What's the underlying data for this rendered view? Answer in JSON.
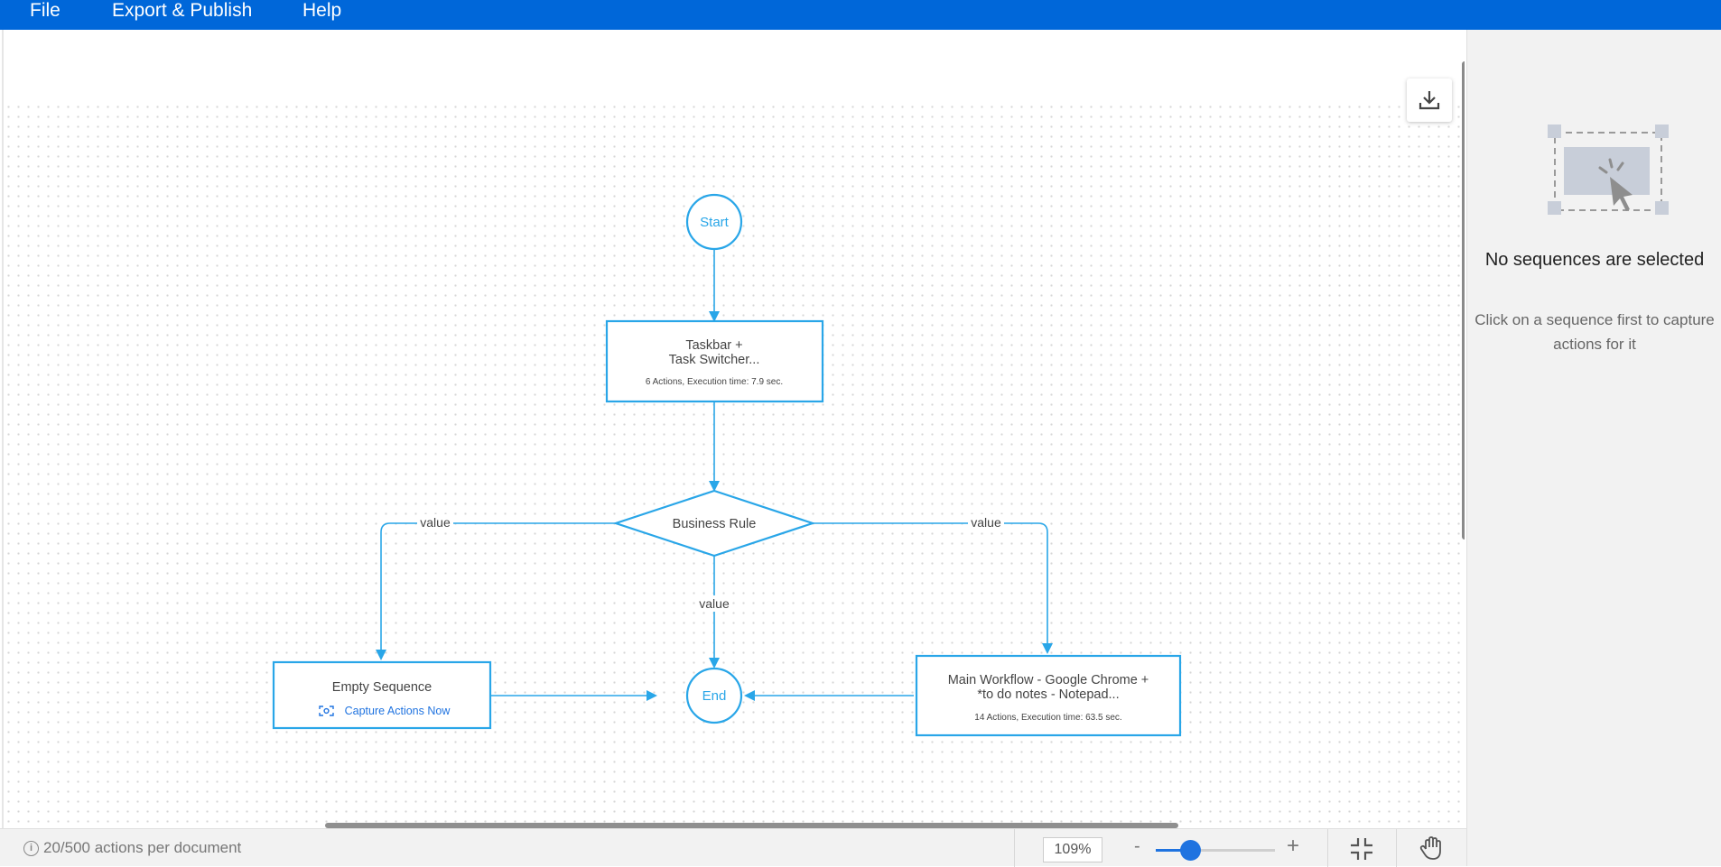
{
  "menu": {
    "file": "File",
    "export": "Export & Publish",
    "help": "Help"
  },
  "diagram": {
    "start": "Start",
    "end": "End",
    "sequence1": {
      "line1": "Taskbar +",
      "line2": "Task Switcher...",
      "meta": "6 Actions, Execution time: 7.9 sec."
    },
    "decision": "Business Rule",
    "edge_left": "value",
    "edge_right": "value",
    "edge_center": "value",
    "sequence_empty": {
      "title": "Empty Sequence",
      "action": "Capture Actions Now"
    },
    "sequence_main": {
      "line1": "Main Workflow - Google Chrome +",
      "line2": "*to do notes - Notepad...",
      "meta": "14 Actions, Execution time: 63.5 sec."
    }
  },
  "panel": {
    "title": "No sequences are selected",
    "subtitle": "Click on a sequence first to capture actions for it"
  },
  "status": {
    "actions": "20/500 actions per document",
    "zoom": "109%",
    "zoom_minus": "-",
    "zoom_plus": "+",
    "zoom_fraction": 0.29
  },
  "colors": {
    "accent": "#29a6e8",
    "menubar": "#0067d9",
    "slider": "#1f73e0"
  },
  "icons": [
    "download-icon",
    "info-icon",
    "fit-screen-icon",
    "hand-icon",
    "capture-icon",
    "select-sequence-illustration"
  ]
}
